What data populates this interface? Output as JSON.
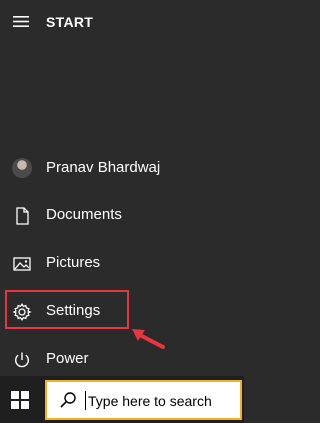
{
  "start_menu": {
    "title": "START",
    "items": [
      {
        "label": "Pranav Bhardwaj",
        "icon": "user-avatar"
      },
      {
        "label": "Documents",
        "icon": "document-icon"
      },
      {
        "label": "Pictures",
        "icon": "pictures-icon"
      },
      {
        "label": "Settings",
        "icon": "gear-icon"
      },
      {
        "label": "Power",
        "icon": "power-icon"
      }
    ]
  },
  "taskbar": {
    "search_placeholder": "Type here to search"
  },
  "colors": {
    "panel_bg": "#2b2b2b",
    "taskbar_bg": "#1f1f1f",
    "highlight": "#e8353f",
    "search_border": "#efb41f"
  }
}
